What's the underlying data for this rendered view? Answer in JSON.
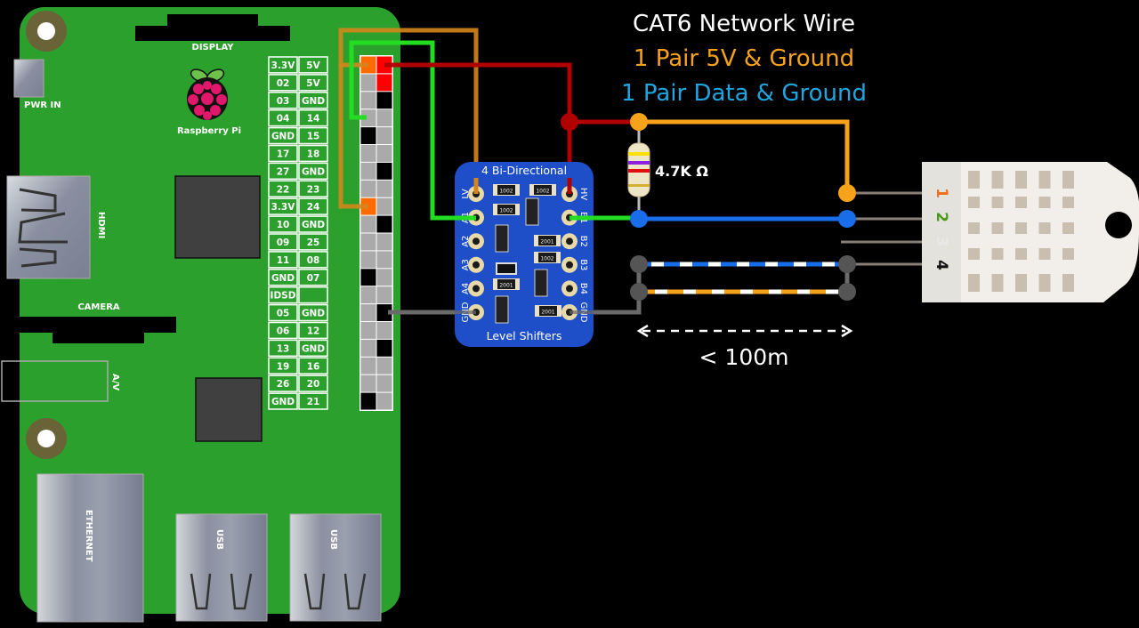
{
  "title": {
    "line1": "CAT6 Network Wire",
    "line2": "1 Pair 5V & Ground",
    "line3": "1 Pair Data & Ground"
  },
  "colors": {
    "background": "#000000",
    "board": "#2ca02c",
    "white_text": "#ffffff",
    "orange": "#f7a21b",
    "orange_wire": "#d4861c",
    "blue_text": "#1fa6e0",
    "blue_wire": "#1a6de8",
    "red_wire": "#b00000",
    "green_wire": "#22dd22",
    "gray_wire": "#6a6a6a",
    "pin_power": "#ff0000",
    "pin_3v3": "#ff6a00",
    "pin_gnd": "#000000",
    "pin_gpio": "#aaaaaa",
    "level_shifter": "#1f4fc8"
  },
  "board": {
    "name": "Raspberry Pi",
    "labels": {
      "display": "DISPLAY",
      "pwr_in": "PWR IN",
      "hdmi": "HDMI",
      "camera": "CAMERA",
      "av": "A/V",
      "ethernet": "ETHERNET",
      "usb1": "USB",
      "usb2": "USB"
    }
  },
  "gpio_header": {
    "rows": [
      {
        "left": "3.3V",
        "right": "5V",
        "left_type": "3v3",
        "right_type": "5v"
      },
      {
        "left": "02",
        "right": "5V",
        "left_type": "gpio",
        "right_type": "5v"
      },
      {
        "left": "03",
        "right": "GND",
        "left_type": "gpio",
        "right_type": "gnd"
      },
      {
        "left": "04",
        "right": "14",
        "left_type": "gpio",
        "right_type": "gpio"
      },
      {
        "left": "GND",
        "right": "15",
        "left_type": "gnd",
        "right_type": "gpio"
      },
      {
        "left": "17",
        "right": "18",
        "left_type": "gpio",
        "right_type": "gpio"
      },
      {
        "left": "27",
        "right": "GND",
        "left_type": "gpio",
        "right_type": "gnd"
      },
      {
        "left": "22",
        "right": "23",
        "left_type": "gpio",
        "right_type": "gpio"
      },
      {
        "left": "3.3V",
        "right": "24",
        "left_type": "3v3",
        "right_type": "gpio"
      },
      {
        "left": "10",
        "right": "GND",
        "left_type": "gpio",
        "right_type": "gnd"
      },
      {
        "left": "09",
        "right": "25",
        "left_type": "gpio",
        "right_type": "gpio"
      },
      {
        "left": "11",
        "right": "08",
        "left_type": "gpio",
        "right_type": "gpio"
      },
      {
        "left": "GND",
        "right": "07",
        "left_type": "gnd",
        "right_type": "gpio"
      },
      {
        "left": "IDSD",
        "right": "",
        "left_type": "gpio",
        "right_type": "gpio"
      },
      {
        "left": "05",
        "right": "GND",
        "left_type": "gpio",
        "right_type": "gnd"
      },
      {
        "left": "06",
        "right": "12",
        "left_type": "gpio",
        "right_type": "gpio"
      },
      {
        "left": "13",
        "right": "GND",
        "left_type": "gpio",
        "right_type": "gnd"
      },
      {
        "left": "19",
        "right": "16",
        "left_type": "gpio",
        "right_type": "gpio"
      },
      {
        "left": "26",
        "right": "20",
        "left_type": "gpio",
        "right_type": "gpio"
      },
      {
        "left": "GND",
        "right": "21",
        "left_type": "gnd",
        "right_type": "gpio"
      }
    ]
  },
  "level_shifter": {
    "title_top": "4 Bi-Directional",
    "title_bottom": "Level Shifters",
    "left_pins": [
      "LV",
      "A1",
      "A2",
      "A3",
      "A4",
      "GND"
    ],
    "right_pins": [
      "HV",
      "B1",
      "B2",
      "B3",
      "B4",
      "GND"
    ],
    "resistor_codes": [
      "1002",
      "1002",
      "1002",
      "2001",
      "1002",
      "2001",
      "2001"
    ]
  },
  "resistor": {
    "label": "4.7K Ω"
  },
  "cable": {
    "distance_label": "< 100m"
  },
  "sensor": {
    "pins": [
      "1",
      "2",
      "3",
      "4"
    ],
    "pin_colors": [
      "#f07020",
      "#4a9a1a",
      "#e8e8e8",
      "#111111"
    ]
  }
}
